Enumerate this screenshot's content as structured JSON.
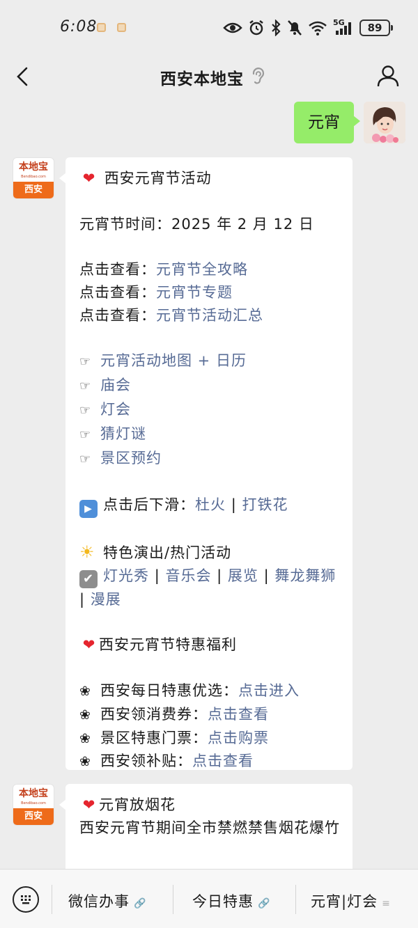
{
  "status_bar": {
    "time": "6:08",
    "network": "5G",
    "battery": "89"
  },
  "header": {
    "title": "西安本地宝"
  },
  "colors": {
    "background": "#ededed",
    "user_bubble": "#95ec69",
    "link": "#576b95",
    "brand_orange": "#ee6b1a",
    "heart": "#e5252e"
  },
  "user_message": {
    "text": "元宵"
  },
  "bot_avatar": {
    "top_text": "本地宝",
    "sub_text": "Bendibao.com",
    "bottom_text": "西安"
  },
  "reply1": {
    "title": "西安元宵节活动",
    "date_line": "元宵节时间：2025 年 2 月 12 日",
    "click_prefix": "点击查看：",
    "click_links": [
      "元宵节全攻略",
      "元宵节专题",
      "元宵节活动汇总"
    ],
    "pointer_links": [
      "元宵活动地图 + 日历",
      "庙会",
      "灯会",
      "猜灯谜",
      "景区预约"
    ],
    "scroll_prefix": "点击后下滑：",
    "scroll_links": [
      "杜火",
      "打铁花"
    ],
    "sep": "|",
    "shows_title": "特色演出/热门活动",
    "shows_links": [
      "灯光秀",
      "音乐会",
      "展览",
      "舞龙舞狮",
      "漫展"
    ],
    "benefits_title": "西安元宵节特惠福利",
    "benefits": [
      {
        "label": "西安每日特惠优选：",
        "link": "点击进入"
      },
      {
        "label": "西安领消费券：",
        "link": "点击查看"
      },
      {
        "label": "景区特惠门票：",
        "link": "点击购票"
      },
      {
        "label": "西安领补贴：",
        "link": "点击查看"
      }
    ]
  },
  "reply2": {
    "title": "元宵放烟花",
    "body": "西安元宵节期间全市禁燃禁售烟花爆竹"
  },
  "bottom_menu": {
    "items": [
      "微信办事",
      "今日特惠",
      "元宵|灯会"
    ]
  }
}
